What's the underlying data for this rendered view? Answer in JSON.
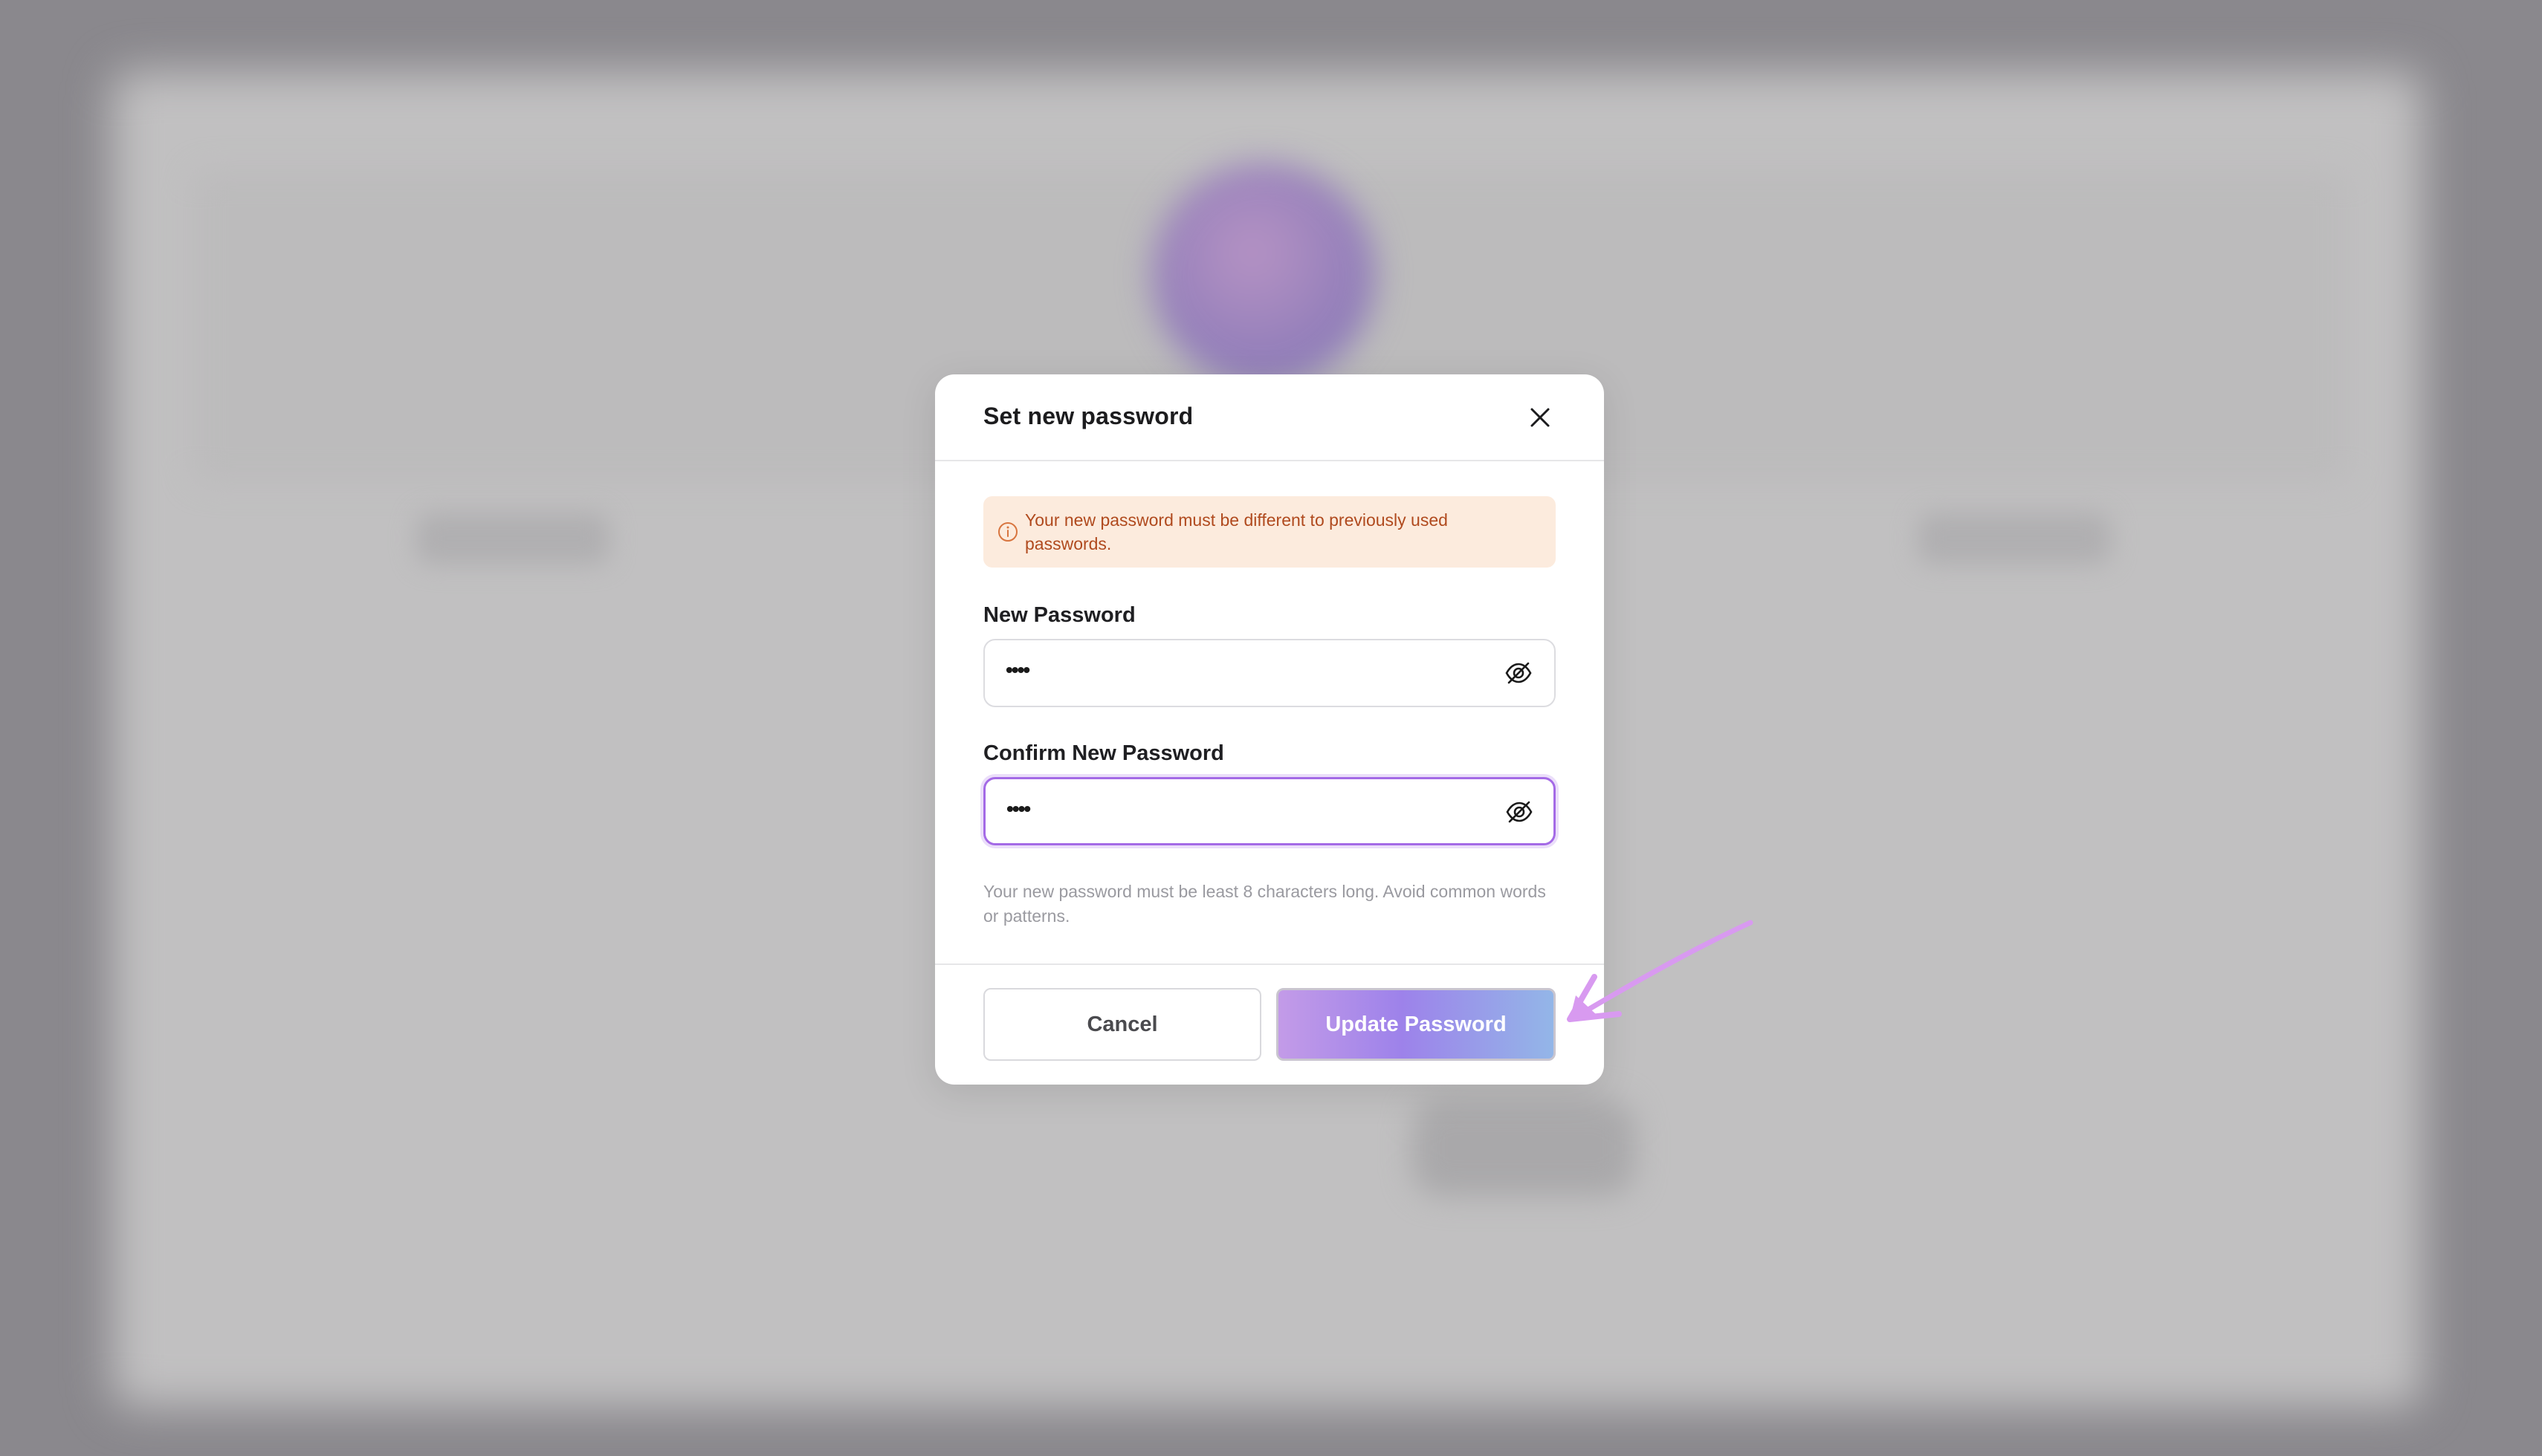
{
  "modal": {
    "title": "Set new password",
    "alert": {
      "text": "Your new password must be different to previously used passwords.",
      "icon": "info-icon",
      "text_color": "#b04a1e",
      "background": "#fcebdd"
    },
    "new_password": {
      "label": "New Password",
      "value": "••••",
      "toggle_icon": "eye-off-icon"
    },
    "confirm_password": {
      "label": "Confirm New Password",
      "value": "••••",
      "toggle_icon": "eye-off-icon",
      "focus_color": "#a46ae6"
    },
    "hint": "Your new password must be least 8 characters long. Avoid common words or patterns.",
    "cancel_label": "Cancel",
    "update_label": "Update Password",
    "update_gradient": [
      "#c39be8",
      "#9d82ea",
      "#93b6e8"
    ]
  },
  "annotation": {
    "icon": "arrow-pointer-icon",
    "color": "#d89af0"
  }
}
